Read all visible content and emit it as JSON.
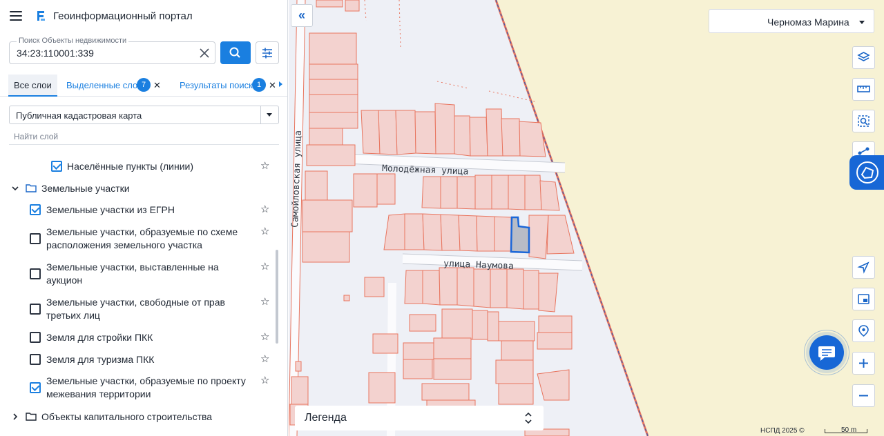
{
  "app": {
    "title": "Геоинформационный портал"
  },
  "search": {
    "legend": "Поиск Объекты недвижимости",
    "value": "34:23:110001:339"
  },
  "tabs": {
    "all": "Все слои",
    "selected": "Выделенные слои",
    "selected_count": "7",
    "results": "Результаты поиска",
    "results_count": "1",
    "close_glyph": "✕"
  },
  "basemap": {
    "value": "Публичная кадастровая карта"
  },
  "layer_search": {
    "placeholder": "Найти слой"
  },
  "layers": {
    "settlements_lines": "Населённые пункты (линии)",
    "land_group": "Земельные участки",
    "egrn": "Земельные участки из ЕГРН",
    "scheme": "Земельные участки, образуемые по схеме расположения земельного участка",
    "auction": "Земельные участки, выставленные на аукцион",
    "free": "Земельные участки, свободные от прав третьих лиц",
    "pkk_build": "Земля для стройки ПКК",
    "pkk_tourism": "Земля для туризма ПКК",
    "survey": "Земельные участки, образуемые по проекту межевания территории",
    "capital_group": "Объекты капитального строительства"
  },
  "layer_states": {
    "settlements_lines": true,
    "egrn": true,
    "scheme": false,
    "auction": false,
    "free": false,
    "pkk_build": false,
    "pkk_tourism": false,
    "survey": true
  },
  "map": {
    "user": "Черномаз Марина",
    "legend": "Легенда",
    "attribution": "НСПД 2025 ©",
    "scale": "50 m",
    "streets": {
      "molodezhnaya": "Молодёжная улица",
      "naumova": "улица Наумова",
      "samoilovskaya": "Самойловская улица"
    }
  },
  "icons": {
    "menu": "hamburger-menu-icon",
    "logo": "portal-logo-icon",
    "clear": "close-icon",
    "search": "search-icon",
    "filter": "filter-sliders-icon",
    "collapse": "double-chevron-left-icon",
    "layers": "layers-icon",
    "ruler": "ruler-icon",
    "select_area": "select-area-icon",
    "share": "share-icon",
    "locate": "navigation-arrow-icon",
    "minimap": "minimap-icon",
    "geo_search": "geo-search-icon",
    "zoom_in": "plus-icon",
    "zoom_out": "minus-icon",
    "chat": "chat-icon",
    "star": "star-icon",
    "folder": "folder-icon"
  },
  "colors": {
    "accent": "#1a7fe0",
    "parcel_stroke": "#e8755f",
    "parcel_fill": "#f3d2cf",
    "selected_parcel": "#1a66d8",
    "outer_zone": "#f7f2d4"
  }
}
